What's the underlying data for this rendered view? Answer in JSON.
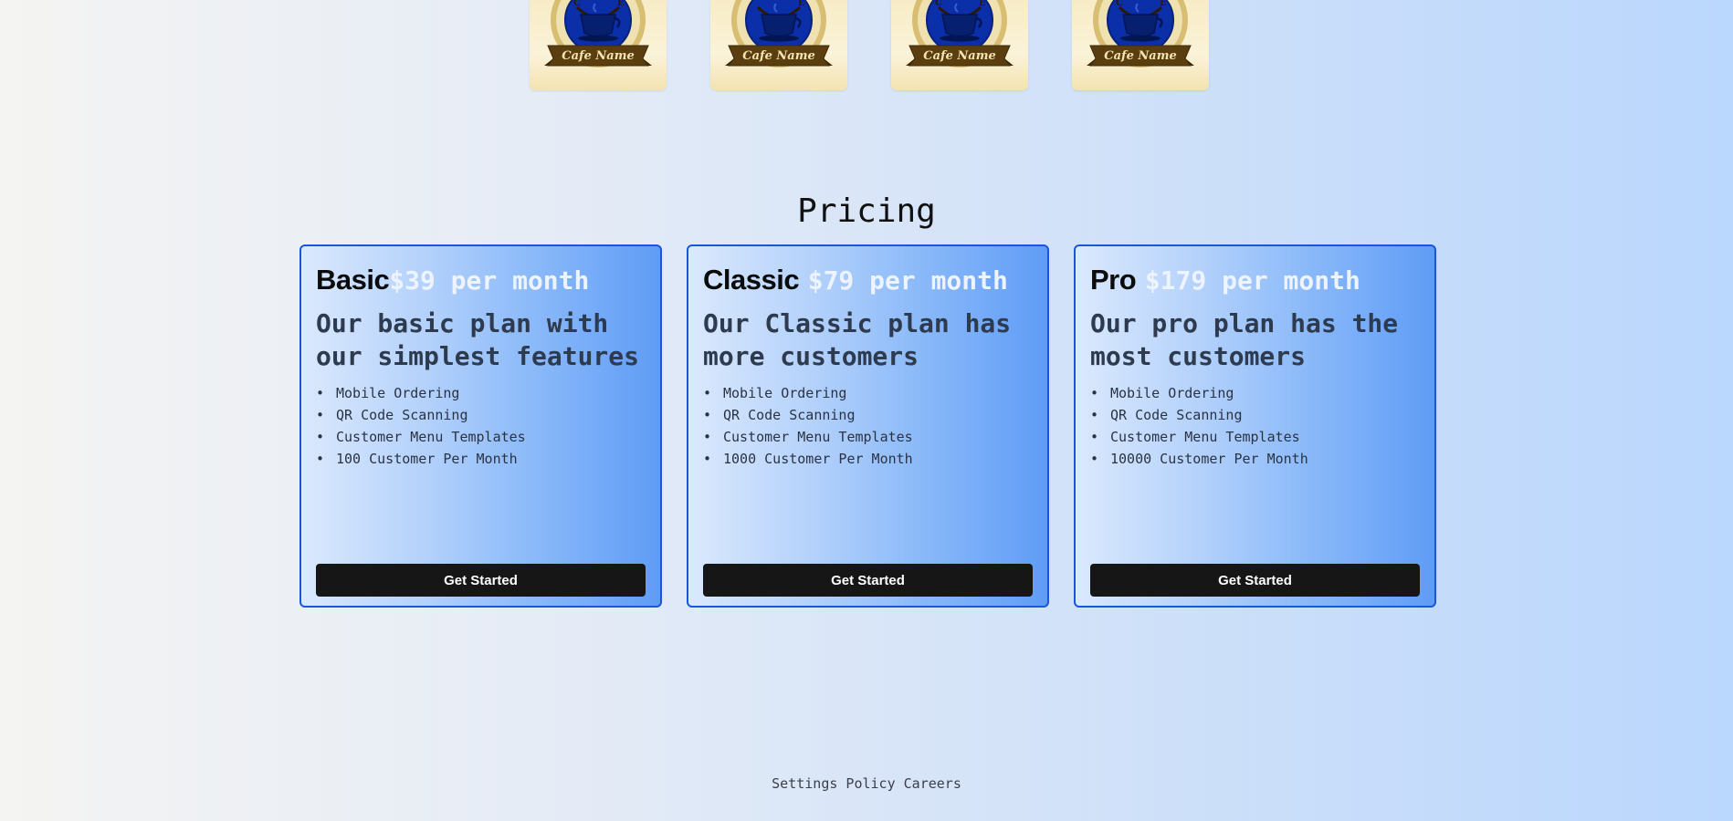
{
  "logos": [
    {
      "banner_text": "Cafe Name",
      "icon": "coffee-cup-icon"
    },
    {
      "banner_text": "Cafe Name",
      "icon": "coffee-cup-icon"
    },
    {
      "banner_text": "Cafe Name",
      "icon": "coffee-cup-icon"
    },
    {
      "banner_text": "Cafe Name",
      "icon": "coffee-cup-icon"
    }
  ],
  "pricing": {
    "title": "Pricing",
    "plans": [
      {
        "name": "Basic",
        "price": "$39 per month",
        "description": "Our basic plan with our simplest features",
        "features": [
          "Mobile Ordering",
          "QR Code Scanning",
          "Customer Menu Templates",
          "100 Customer Per Month"
        ],
        "cta": "Get Started"
      },
      {
        "name": "Classic",
        "price": "$79 per month",
        "description": "Our Classic plan has more customers",
        "features": [
          "Mobile Ordering",
          "QR Code Scanning",
          "Customer Menu Templates",
          "1000 Customer Per Month"
        ],
        "cta": "Get Started"
      },
      {
        "name": "Pro",
        "price": "$179 per month",
        "description": "Our pro plan has the most customers",
        "features": [
          "Mobile Ordering",
          "QR Code Scanning",
          "Customer Menu Templates",
          "10000 Customer Per Month"
        ],
        "cta": "Get Started"
      }
    ]
  },
  "footer": {
    "links": [
      "Settings",
      "Policy",
      "Careers"
    ]
  },
  "colors": {
    "card_border": "#1a56db",
    "button_bg": "#161616",
    "price_text": "#eef4ff",
    "logo_blue": "#0a2fa8",
    "logo_gold": "#c9a54a",
    "logo_banner": "#5a3e10"
  }
}
